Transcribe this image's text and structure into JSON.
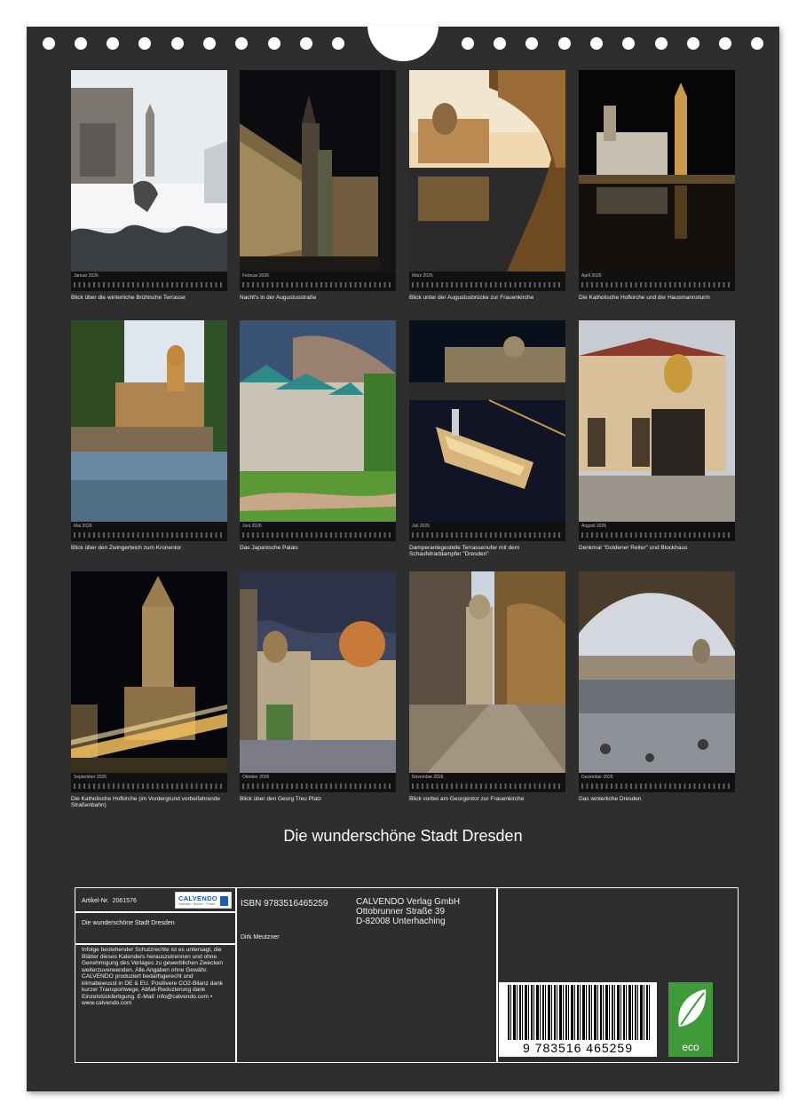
{
  "colors": {
    "sheet": "#2e2e2e",
    "strip": "#111111",
    "text": "#f0f0f0",
    "eco_green": "#3f9b3a",
    "logo_blue": "#1f5ea8"
  },
  "year": "2026",
  "months": [
    {
      "name": "Januar",
      "caption": "Blick über die winterliche Brühlsche Terrasse"
    },
    {
      "name": "Februar",
      "caption": "Nacht's in der Augustusstraße"
    },
    {
      "name": "März",
      "caption": "Blick unter der Augustusbrücke zur Frauenkirche"
    },
    {
      "name": "April",
      "caption": "Die Katholische Hofkirche und der Hausmannsturm"
    },
    {
      "name": "Mai",
      "caption": "Blick über den Zwingerteich zum Kronentor"
    },
    {
      "name": "Juni",
      "caption": "Das Japanische Palais"
    },
    {
      "name": "Juli",
      "caption": "Damperanlegestelle Terrassenufer mit dem Schaufelraddampfer \"Dresden\""
    },
    {
      "name": "August",
      "caption": "Denkmal \"Goldener Reiter\" und Blockhaus"
    },
    {
      "name": "September",
      "caption": "Die Katholische Hofkirche (im Vordergrund vorbeifahrende Straßenbahn)"
    },
    {
      "name": "Oktober",
      "caption": "Blick über den Georg Treu Platz"
    },
    {
      "name": "November",
      "caption": "Blick vorbei am Georgentor zur Frauenkirche"
    },
    {
      "name": "Dezember",
      "caption": "Das winterliche Dresden"
    }
  ],
  "calendar_title": "Die wunderschöne Stadt Dresden",
  "info": {
    "article_label": "Artikel-Nr.",
    "article_number": "2061576",
    "logo_text": "CALVENDO",
    "logo_subtext": "Kalender · Bücher · Poster",
    "title_small": "Die wunderschöne Stadt Dresden",
    "legal": "Infolge bestehender Schutzrechte ist es untersagt, die Blätter dieses Kalenders herauszutrennen und ohne Genehmigung des Verlages zu gewerblichen Zwecken weiterzuverwenden. Alle Angaben ohne Gewähr. CALVENDO produziert bedarfsgerecht und klimabewusst in DE & EU. Positivere CO2-Bilanz dank kurzer Transportwege, Abfall-Reduzierung dank Einzelstückfertigung. E-Mail: info@calvendo.com • www.calvendo.com",
    "isbn": "ISBN 9783516465259",
    "author": "Dirk Meutzner",
    "publisher_line1": "CALVENDO Verlag GmbH",
    "publisher_line2": "Ottobrunner Straße 39",
    "publisher_line3": "D-82008 Unterhaching",
    "barcode_digits": "9 783516 465259",
    "eco_label": "eco"
  }
}
